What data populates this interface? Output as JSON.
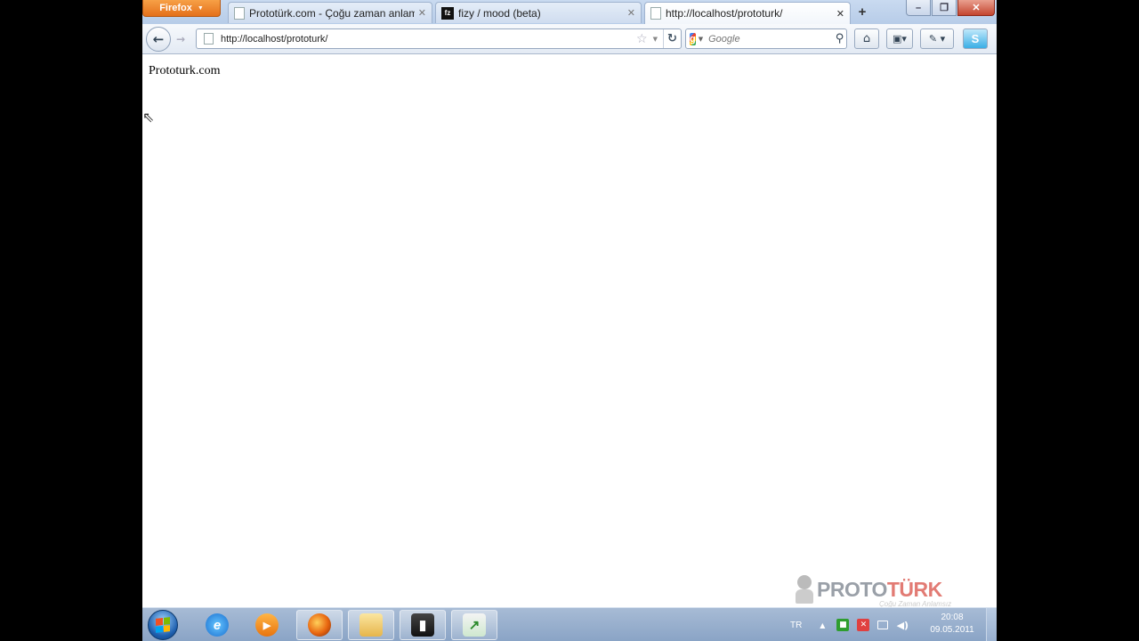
{
  "browser": {
    "menu_button": "Firefox",
    "tabs": [
      {
        "title": "Prototürk.com - Çoğu zaman anlams...",
        "icon": "page-icon"
      },
      {
        "title": "fizy / mood (beta)",
        "icon": "fizy-icon",
        "icon_text": "fz"
      },
      {
        "title": "http://localhost/prototurk/",
        "icon": "page-icon",
        "active": true
      }
    ],
    "new_tab": "+",
    "window_controls": {
      "minimize": "–",
      "maximize": "❐",
      "close": "✕"
    }
  },
  "navbar": {
    "url": "http://localhost/prototurk/",
    "search_placeholder": "Google",
    "search_engine_letter": "g"
  },
  "page": {
    "text": "Prototurk.com"
  },
  "watermark": {
    "proto": "PROTO",
    "turk": "TÜRK",
    "slogan": "Çoğu Zaman Anlamsız"
  },
  "taskbar": {
    "apps": [
      "ie-icon",
      "media-player-icon",
      "firefox-icon",
      "explorer-icon",
      "camera-icon",
      "spreadsheet-icon"
    ],
    "language": "TR",
    "clock": {
      "time": "20:08",
      "date": "09.05.2011"
    }
  },
  "colors": {
    "firefox_orange": "#e4701b",
    "taskbar_blue": "#8aa4c6",
    "watermark_red": "#e27b74"
  }
}
